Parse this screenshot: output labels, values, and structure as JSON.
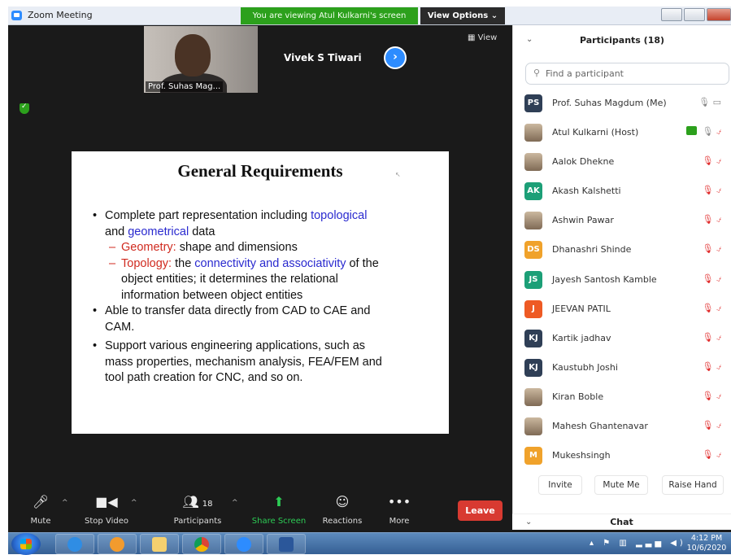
{
  "window": {
    "title": "Zoom Meeting",
    "viewing_banner": "You are viewing Atul Kulkarni's screen",
    "view_options": "View Options ⌄"
  },
  "video": {
    "self_name": "Prof. Suhas Mag...",
    "other_name": "Vivek S Tiwari",
    "view_label": "▦ View"
  },
  "slide": {
    "title": "General Requirements",
    "b1_pre": "Complete part representation including ",
    "b1_topo": "topological",
    "b1_and": "and ",
    "b1_geo": "geometrical",
    "b1_post": " data",
    "s1_term": "Geometry:",
    "s1_rest": " shape and dimensions",
    "s2_term": "Topology:",
    "s2_mid": "  the ",
    "s2_blue": "connectivity and associativity",
    "s2_post": " of the",
    "s2_line2": "object entities; it determines the relational",
    "s2_line3": "information between object entities",
    "b2_line1": "Able to transfer data directly from CAD to CAE and",
    "b2_line2": "CAM.",
    "b3_line1": "Support various engineering applications, such as",
    "b3_line2": "mass properties, mechanism analysis, FEA/FEM and",
    "b3_line3": "tool path creation for CNC, and so on."
  },
  "toolbar": {
    "mute": "Mute",
    "stop_video": "Stop Video",
    "participants": "Participants",
    "participants_count": "18",
    "share_screen": "Share Screen",
    "reactions": "Reactions",
    "more": "More",
    "leave": "Leave"
  },
  "panel": {
    "title": "Participants (18)",
    "search_placeholder": "Find a participant",
    "participants": [
      {
        "initials": "PS",
        "name": "Prof. Suhas Magdum (Me)",
        "color": "#2f3f56"
      },
      {
        "initials": "",
        "name": "Atul Kulkarni (Host)",
        "color": ""
      },
      {
        "initials": "",
        "name": "Aalok Dhekne",
        "color": ""
      },
      {
        "initials": "AK",
        "name": "Akash Kalshetti",
        "color": "#1c9f77"
      },
      {
        "initials": "",
        "name": "Ashwin Pawar",
        "color": ""
      },
      {
        "initials": "DS",
        "name": "Dhanashri Shinde",
        "color": "#f0a22b"
      },
      {
        "initials": "JS",
        "name": "Jayesh Santosh Kamble",
        "color": "#1c9f77"
      },
      {
        "initials": "J",
        "name": "JEEVAN PATIL",
        "color": "#ee5a24"
      },
      {
        "initials": "KJ",
        "name": "Kartik jadhav",
        "color": "#2f3f56"
      },
      {
        "initials": "KJ",
        "name": "Kaustubh Joshi",
        "color": "#2f3f56"
      },
      {
        "initials": "",
        "name": "Kiran Boble",
        "color": ""
      },
      {
        "initials": "",
        "name": "Mahesh Ghantenavar",
        "color": ""
      },
      {
        "initials": "M",
        "name": "Mukeshsingh",
        "color": "#f0a22b"
      }
    ],
    "invite": "Invite",
    "mute_me": "Mute Me",
    "raise_hand": "Raise Hand",
    "chat": "Chat"
  },
  "taskbar": {
    "time": "4:12 PM",
    "date": "10/6/2020"
  }
}
